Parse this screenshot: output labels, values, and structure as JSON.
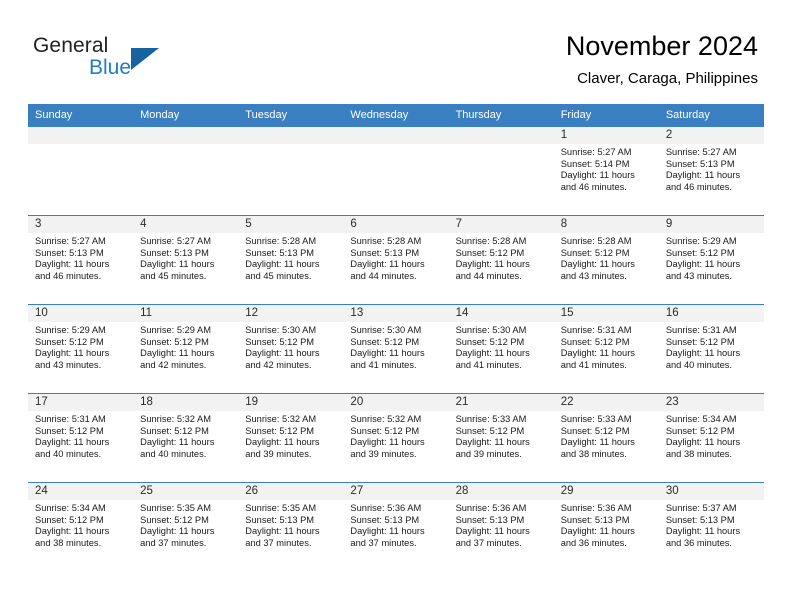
{
  "brand": {
    "word_one": "General",
    "word_two": "Blue",
    "triangle_color": "#17639f",
    "blue_color": "#1f7ec4"
  },
  "header": {
    "title": "November 2024",
    "subtitle": "Claver, Caraga, Philippines"
  },
  "theme": {
    "header_bg": "#3a7fc1",
    "daynum_bg": "#f2f2f2",
    "text": "#1a1a1a"
  },
  "calendar": {
    "weekday_headers": [
      "Sunday",
      "Monday",
      "Tuesday",
      "Wednesday",
      "Thursday",
      "Friday",
      "Saturday"
    ],
    "weeks": [
      [
        {
          "day": "",
          "empty": true
        },
        {
          "day": "",
          "empty": true
        },
        {
          "day": "",
          "empty": true
        },
        {
          "day": "",
          "empty": true
        },
        {
          "day": "",
          "empty": true
        },
        {
          "day": "1",
          "sunrise": "Sunrise: 5:27 AM",
          "sunset": "Sunset: 5:14 PM",
          "daylight_1": "Daylight: 11 hours",
          "daylight_2": "and 46 minutes."
        },
        {
          "day": "2",
          "sunrise": "Sunrise: 5:27 AM",
          "sunset": "Sunset: 5:13 PM",
          "daylight_1": "Daylight: 11 hours",
          "daylight_2": "and 46 minutes."
        }
      ],
      [
        {
          "day": "3",
          "sunrise": "Sunrise: 5:27 AM",
          "sunset": "Sunset: 5:13 PM",
          "daylight_1": "Daylight: 11 hours",
          "daylight_2": "and 46 minutes."
        },
        {
          "day": "4",
          "sunrise": "Sunrise: 5:27 AM",
          "sunset": "Sunset: 5:13 PM",
          "daylight_1": "Daylight: 11 hours",
          "daylight_2": "and 45 minutes."
        },
        {
          "day": "5",
          "sunrise": "Sunrise: 5:28 AM",
          "sunset": "Sunset: 5:13 PM",
          "daylight_1": "Daylight: 11 hours",
          "daylight_2": "and 45 minutes."
        },
        {
          "day": "6",
          "sunrise": "Sunrise: 5:28 AM",
          "sunset": "Sunset: 5:13 PM",
          "daylight_1": "Daylight: 11 hours",
          "daylight_2": "and 44 minutes."
        },
        {
          "day": "7",
          "sunrise": "Sunrise: 5:28 AM",
          "sunset": "Sunset: 5:12 PM",
          "daylight_1": "Daylight: 11 hours",
          "daylight_2": "and 44 minutes."
        },
        {
          "day": "8",
          "sunrise": "Sunrise: 5:28 AM",
          "sunset": "Sunset: 5:12 PM",
          "daylight_1": "Daylight: 11 hours",
          "daylight_2": "and 43 minutes."
        },
        {
          "day": "9",
          "sunrise": "Sunrise: 5:29 AM",
          "sunset": "Sunset: 5:12 PM",
          "daylight_1": "Daylight: 11 hours",
          "daylight_2": "and 43 minutes."
        }
      ],
      [
        {
          "day": "10",
          "sunrise": "Sunrise: 5:29 AM",
          "sunset": "Sunset: 5:12 PM",
          "daylight_1": "Daylight: 11 hours",
          "daylight_2": "and 43 minutes."
        },
        {
          "day": "11",
          "sunrise": "Sunrise: 5:29 AM",
          "sunset": "Sunset: 5:12 PM",
          "daylight_1": "Daylight: 11 hours",
          "daylight_2": "and 42 minutes."
        },
        {
          "day": "12",
          "sunrise": "Sunrise: 5:30 AM",
          "sunset": "Sunset: 5:12 PM",
          "daylight_1": "Daylight: 11 hours",
          "daylight_2": "and 42 minutes."
        },
        {
          "day": "13",
          "sunrise": "Sunrise: 5:30 AM",
          "sunset": "Sunset: 5:12 PM",
          "daylight_1": "Daylight: 11 hours",
          "daylight_2": "and 41 minutes."
        },
        {
          "day": "14",
          "sunrise": "Sunrise: 5:30 AM",
          "sunset": "Sunset: 5:12 PM",
          "daylight_1": "Daylight: 11 hours",
          "daylight_2": "and 41 minutes."
        },
        {
          "day": "15",
          "sunrise": "Sunrise: 5:31 AM",
          "sunset": "Sunset: 5:12 PM",
          "daylight_1": "Daylight: 11 hours",
          "daylight_2": "and 41 minutes."
        },
        {
          "day": "16",
          "sunrise": "Sunrise: 5:31 AM",
          "sunset": "Sunset: 5:12 PM",
          "daylight_1": "Daylight: 11 hours",
          "daylight_2": "and 40 minutes."
        }
      ],
      [
        {
          "day": "17",
          "sunrise": "Sunrise: 5:31 AM",
          "sunset": "Sunset: 5:12 PM",
          "daylight_1": "Daylight: 11 hours",
          "daylight_2": "and 40 minutes."
        },
        {
          "day": "18",
          "sunrise": "Sunrise: 5:32 AM",
          "sunset": "Sunset: 5:12 PM",
          "daylight_1": "Daylight: 11 hours",
          "daylight_2": "and 40 minutes."
        },
        {
          "day": "19",
          "sunrise": "Sunrise: 5:32 AM",
          "sunset": "Sunset: 5:12 PM",
          "daylight_1": "Daylight: 11 hours",
          "daylight_2": "and 39 minutes."
        },
        {
          "day": "20",
          "sunrise": "Sunrise: 5:32 AM",
          "sunset": "Sunset: 5:12 PM",
          "daylight_1": "Daylight: 11 hours",
          "daylight_2": "and 39 minutes."
        },
        {
          "day": "21",
          "sunrise": "Sunrise: 5:33 AM",
          "sunset": "Sunset: 5:12 PM",
          "daylight_1": "Daylight: 11 hours",
          "daylight_2": "and 39 minutes."
        },
        {
          "day": "22",
          "sunrise": "Sunrise: 5:33 AM",
          "sunset": "Sunset: 5:12 PM",
          "daylight_1": "Daylight: 11 hours",
          "daylight_2": "and 38 minutes."
        },
        {
          "day": "23",
          "sunrise": "Sunrise: 5:34 AM",
          "sunset": "Sunset: 5:12 PM",
          "daylight_1": "Daylight: 11 hours",
          "daylight_2": "and 38 minutes."
        }
      ],
      [
        {
          "day": "24",
          "sunrise": "Sunrise: 5:34 AM",
          "sunset": "Sunset: 5:12 PM",
          "daylight_1": "Daylight: 11 hours",
          "daylight_2": "and 38 minutes."
        },
        {
          "day": "25",
          "sunrise": "Sunrise: 5:35 AM",
          "sunset": "Sunset: 5:12 PM",
          "daylight_1": "Daylight: 11 hours",
          "daylight_2": "and 37 minutes."
        },
        {
          "day": "26",
          "sunrise": "Sunrise: 5:35 AM",
          "sunset": "Sunset: 5:13 PM",
          "daylight_1": "Daylight: 11 hours",
          "daylight_2": "and 37 minutes."
        },
        {
          "day": "27",
          "sunrise": "Sunrise: 5:36 AM",
          "sunset": "Sunset: 5:13 PM",
          "daylight_1": "Daylight: 11 hours",
          "daylight_2": "and 37 minutes."
        },
        {
          "day": "28",
          "sunrise": "Sunrise: 5:36 AM",
          "sunset": "Sunset: 5:13 PM",
          "daylight_1": "Daylight: 11 hours",
          "daylight_2": "and 37 minutes."
        },
        {
          "day": "29",
          "sunrise": "Sunrise: 5:36 AM",
          "sunset": "Sunset: 5:13 PM",
          "daylight_1": "Daylight: 11 hours",
          "daylight_2": "and 36 minutes."
        },
        {
          "day": "30",
          "sunrise": "Sunrise: 5:37 AM",
          "sunset": "Sunset: 5:13 PM",
          "daylight_1": "Daylight: 11 hours",
          "daylight_2": "and 36 minutes."
        }
      ]
    ]
  }
}
